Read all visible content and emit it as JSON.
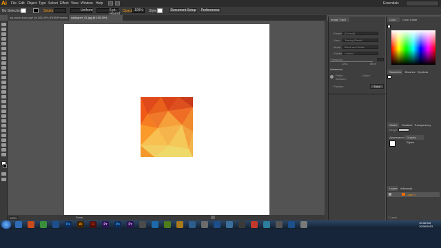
{
  "menubar": {
    "logo": "Ai",
    "items": [
      "File",
      "Edit",
      "Object",
      "Type",
      "Select",
      "Effect",
      "View",
      "Window",
      "Help"
    ],
    "workspace": "Essentials"
  },
  "controlbar": {
    "selection": "No Selection",
    "stroke_label": "Stroke:",
    "stroke_profile": "Uniform",
    "brush": "5 pt. Round",
    "opacity_label": "Opacity:",
    "opacity_value": "100%",
    "style_label": "Style:",
    "doc_setup": "Document Setup",
    "preferences": "Preferences"
  },
  "tabs": [
    {
      "label": "wp-nkorb-icon.png* @ 105.39% (RGB/Preview)"
    },
    {
      "label": "wallpaper_01.jpg @ 105.39% (RGB/Preview)"
    }
  ],
  "status": {
    "zoom": "100%",
    "mode": "Zoom"
  },
  "panels": {
    "image_trace": {
      "title": "Image Trace",
      "preset_label": "Preset:",
      "preset": "[Default]",
      "view_label": "View:",
      "view": "Tracing Result",
      "mode_label": "Mode:",
      "mode": "Black and White",
      "palette_label": "Palette:",
      "palette": "Limited",
      "threshold_label": "Threshold:",
      "less": "Less",
      "more": "More",
      "advanced": "Advanced",
      "paths_label": "Paths:",
      "anchors_label": "Anchors:",
      "colors_label": "Colors:",
      "preview": "Preview",
      "trace": "Trace"
    },
    "color": {
      "tab1": "Color",
      "tab2": "Color Guide"
    },
    "swatches": {
      "tab1": "Swatches",
      "tab2": "Brushes",
      "tab3": "Symbols"
    },
    "stroke": {
      "tab1": "Stroke",
      "tab2": "Gradient",
      "tab3": "Transparency",
      "weight_label": "Weight:"
    },
    "appearance": {
      "tab1": "Appearance",
      "tab2": "Graphic Styles"
    },
    "layers": {
      "tab1": "Layers",
      "tab2": "Artboards",
      "layer_name": "Layer 1",
      "count": "1 Layer"
    }
  },
  "taskbar": {
    "apps": [
      "",
      "",
      "",
      "",
      "Ps",
      "Ai",
      "Fl",
      "Pr",
      "Ps",
      "Pr",
      "",
      "",
      "",
      "",
      "",
      "",
      "",
      "",
      "",
      "",
      "",
      "",
      "",
      ""
    ],
    "time": "10:46 AM",
    "date": "10/26/2013"
  },
  "colors": {
    "accent": "#ff9a00",
    "artboard": "#ffffff",
    "workspace": "#535353"
  }
}
